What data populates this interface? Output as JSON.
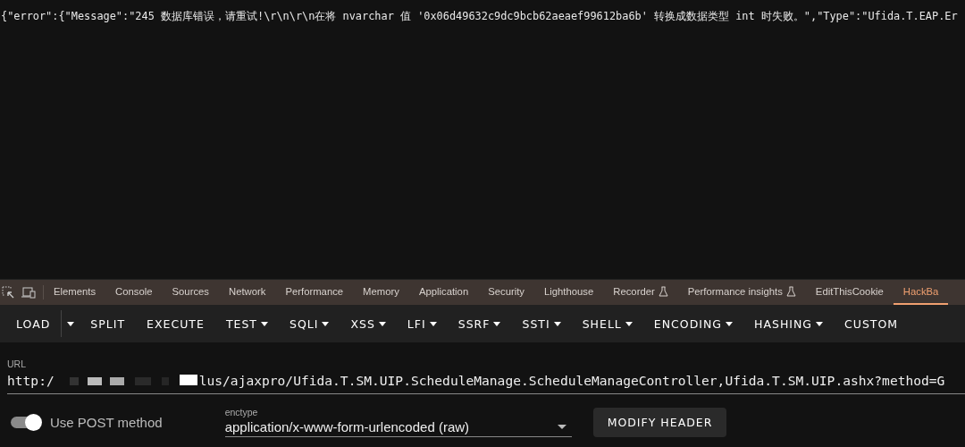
{
  "response_text": "{\"error\":{\"Message\":\"245 数据库错误，请重试!\\r\\n\\r\\n在将 nvarchar 值 '0x06d49632c9dc9bcb62aeaef99612ba6b' 转换成数据类型 int 时失败。\",\"Type\":\"Ufida.T.EAP.Er",
  "devtools_tabs": [
    {
      "label": "Elements",
      "selected": false,
      "experimental": false
    },
    {
      "label": "Console",
      "selected": false,
      "experimental": false
    },
    {
      "label": "Sources",
      "selected": false,
      "experimental": false
    },
    {
      "label": "Network",
      "selected": false,
      "experimental": false
    },
    {
      "label": "Performance",
      "selected": false,
      "experimental": false
    },
    {
      "label": "Memory",
      "selected": false,
      "experimental": false
    },
    {
      "label": "Application",
      "selected": false,
      "experimental": false
    },
    {
      "label": "Security",
      "selected": false,
      "experimental": false
    },
    {
      "label": "Lighthouse",
      "selected": false,
      "experimental": false
    },
    {
      "label": "Recorder",
      "selected": false,
      "experimental": true
    },
    {
      "label": "Performance insights",
      "selected": false,
      "experimental": true
    },
    {
      "label": "EditThisCookie",
      "selected": false,
      "experimental": false
    },
    {
      "label": "HackBa",
      "selected": true,
      "experimental": false
    }
  ],
  "toolbar": [
    {
      "label": "LOAD",
      "kind": "split"
    },
    {
      "label": "SPLIT",
      "kind": "plain"
    },
    {
      "label": "EXECUTE",
      "kind": "plain"
    },
    {
      "label": "TEST",
      "kind": "menu"
    },
    {
      "label": "SQLI",
      "kind": "menu"
    },
    {
      "label": "XSS",
      "kind": "menu"
    },
    {
      "label": "LFI",
      "kind": "menu"
    },
    {
      "label": "SSRF",
      "kind": "menu"
    },
    {
      "label": "SSTI",
      "kind": "menu"
    },
    {
      "label": "SHELL",
      "kind": "menu"
    },
    {
      "label": "ENCODING",
      "kind": "menu"
    },
    {
      "label": "HASHING",
      "kind": "menu"
    },
    {
      "label": "CUSTOM",
      "kind": "plain"
    }
  ],
  "url": {
    "label": "URL",
    "value_start": "http:/",
    "value_end": "lus/ajaxpro/Ufida.T.SM.UIP.ScheduleManage.ScheduleManageController,Ufida.T.SM.UIP.ashx?method=G"
  },
  "post_toggle": {
    "label": "Use POST method",
    "on": true
  },
  "enctype": {
    "label": "enctype",
    "value": "application/x-www-form-urlencoded (raw)"
  },
  "modify_header": {
    "label": "MODIFY HEADER"
  }
}
